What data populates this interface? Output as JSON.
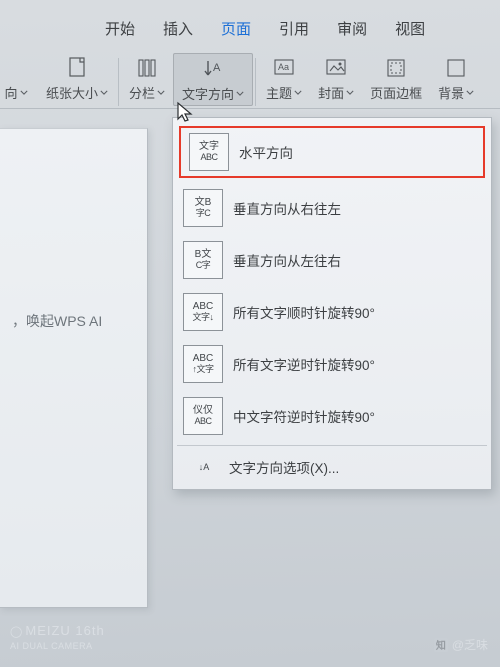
{
  "tabs": {
    "items": [
      "开始",
      "插入",
      "页面",
      "引用",
      "审阅",
      "视图"
    ],
    "active_index": 2
  },
  "ribbon": {
    "groups": [
      {
        "label": "向",
        "dropdown": true
      },
      {
        "label": "纸张大小",
        "dropdown": true
      },
      {
        "label": "分栏",
        "dropdown": true
      },
      {
        "label": "文字方向",
        "dropdown": true,
        "active": true
      },
      {
        "label": "主题",
        "dropdown": true
      },
      {
        "label": "封面",
        "dropdown": true
      },
      {
        "label": "页面边框"
      },
      {
        "label": "背景",
        "dropdown": true
      }
    ]
  },
  "menu": {
    "items": [
      {
        "icon_top": "文字",
        "icon_bot": "ABC",
        "label": "水平方向",
        "highlight": true
      },
      {
        "icon_top": "文B",
        "icon_bot": "字C",
        "label": "垂直方向从右往左"
      },
      {
        "icon_top": "B文",
        "icon_bot": "C字",
        "label": "垂直方向从左往右"
      },
      {
        "icon_top": "ABC",
        "icon_bot": "文字↓",
        "label": "所有文字顺时针旋转90°"
      },
      {
        "icon_top": "ABC",
        "icon_bot": "↑文字",
        "label": "所有文字逆时针旋转90°"
      },
      {
        "icon_top": "仪仅",
        "icon_bot": "ABC",
        "label": "中文字符逆时针旋转90°"
      }
    ],
    "options_label": "文字方向选项(X)..."
  },
  "document_hint": "，唤起WPS AI",
  "watermark": {
    "brand": "MEIZU 16th",
    "sub": "AI DUAL CAMERA",
    "author": "@乏味",
    "zhihu": "知"
  }
}
